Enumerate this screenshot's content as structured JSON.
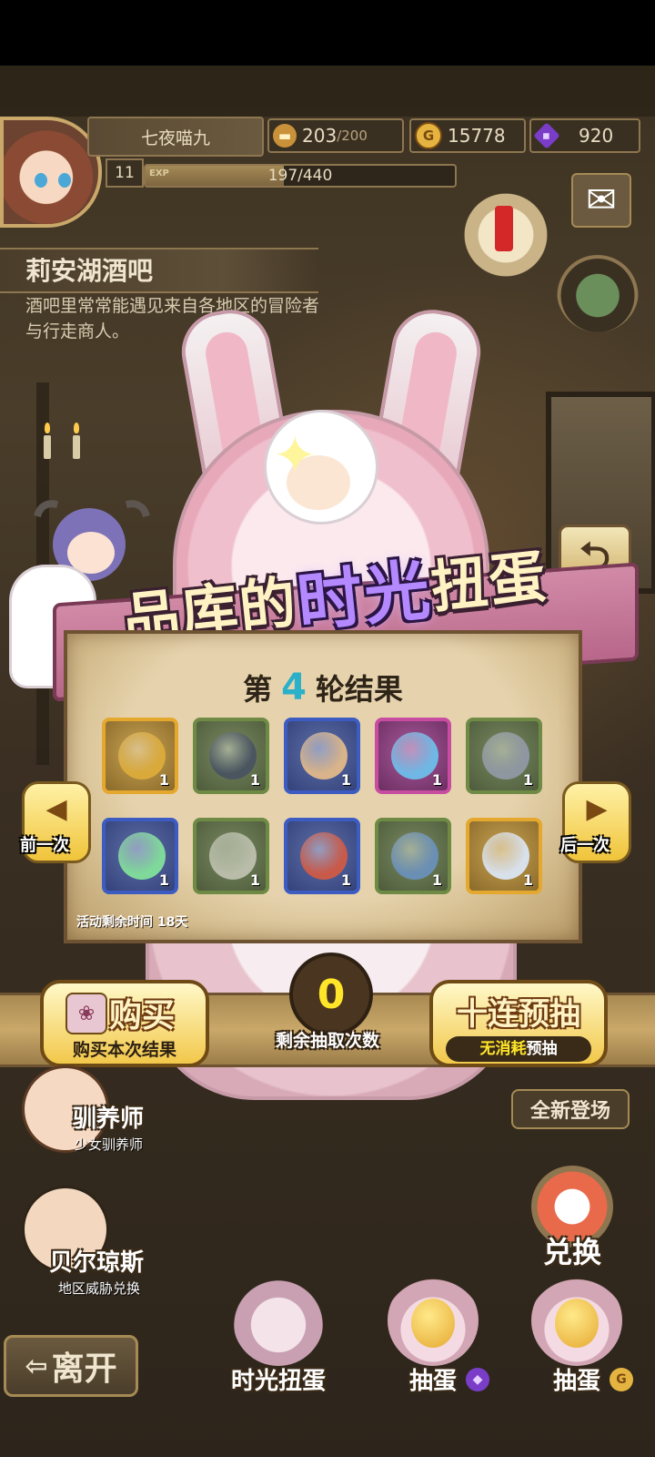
{
  "player": {
    "name": "七夜喵九",
    "level": "11",
    "exp_tag": "EXP",
    "exp_text": "197/440",
    "exp_fraction": 0.448
  },
  "resources": {
    "stamina_value": "203",
    "stamina_max": "/200",
    "gold": "15778",
    "gems": "920"
  },
  "location": {
    "title": "莉安湖酒吧",
    "description": "酒吧里常常能遇见来自各地区的冒险者与行走商人。"
  },
  "event": {
    "title_part1": "品库的",
    "title_highlight": "时光",
    "title_part2": "扭蛋",
    "round_prefix": "第",
    "round_number": "4",
    "round_suffix": "轮结果",
    "remaining_time": "活动剩余时间 18天",
    "items": [
      {
        "name": "golden-lamp",
        "rarity": "gold",
        "qty": "1",
        "art_color": "#d9a93a"
      },
      {
        "name": "turtle-shell",
        "rarity": "green",
        "qty": "1",
        "art_color": "#4a5560"
      },
      {
        "name": "feathered-hat",
        "rarity": "blue",
        "qty": "1",
        "art_color": "#d9b48a"
      },
      {
        "name": "water-spirit",
        "rarity": "pink",
        "qty": "1",
        "art_color": "#6fb8e6"
      },
      {
        "name": "grey-stone",
        "rarity": "green",
        "qty": "1",
        "art_color": "#8e96a0"
      },
      {
        "name": "green-slime",
        "rarity": "blue",
        "qty": "1",
        "art_color": "#7fd99a"
      },
      {
        "name": "leaf",
        "rarity": "green",
        "qty": "1",
        "art_color": "#b8bca8"
      },
      {
        "name": "red-hood",
        "rarity": "blue",
        "qty": "1",
        "art_color": "#c85a4a"
      },
      {
        "name": "sprout-seed",
        "rarity": "green",
        "qty": "1",
        "art_color": "#6a8fb4"
      },
      {
        "name": "fancy-sword",
        "rarity": "gold",
        "qty": "1",
        "art_color": "#d8e0ea"
      }
    ],
    "prev_label": "前一次",
    "next_label": "后一次",
    "draws_left": "0",
    "draws_left_label": "剩余抽取次数",
    "buy_label": "购买",
    "buy_sub": "购买本次结果",
    "ten_label": "十连预抽",
    "ten_sub_hl": "无消耗",
    "ten_sub": "预抽"
  },
  "npcs": [
    {
      "name": "驯养师",
      "sub": "少女驯养师"
    },
    {
      "name": "贝尔琼斯",
      "sub": "地区威胁兑换"
    }
  ],
  "right_menu": {
    "new_tag": "全新登场",
    "exchange": "兑换"
  },
  "dock": {
    "leave": "离开",
    "time_gacha": "时光扭蛋",
    "gacha_gem": "抽蛋",
    "gacha_gold": "抽蛋"
  },
  "colors": {
    "gold_rarity": "#e5a82f",
    "green_rarity": "#6e8a44",
    "blue_rarity": "#3c5cc2",
    "pink_rarity": "#c84da0",
    "counter": "#ffe629",
    "round_number": "#2ab0c8"
  },
  "icons": {
    "stamina": "bread-icon",
    "gold": "gold-coin-icon",
    "gems": "purple-gem-icon",
    "mail": "envelope-icon",
    "back": "return-arrow-icon"
  }
}
